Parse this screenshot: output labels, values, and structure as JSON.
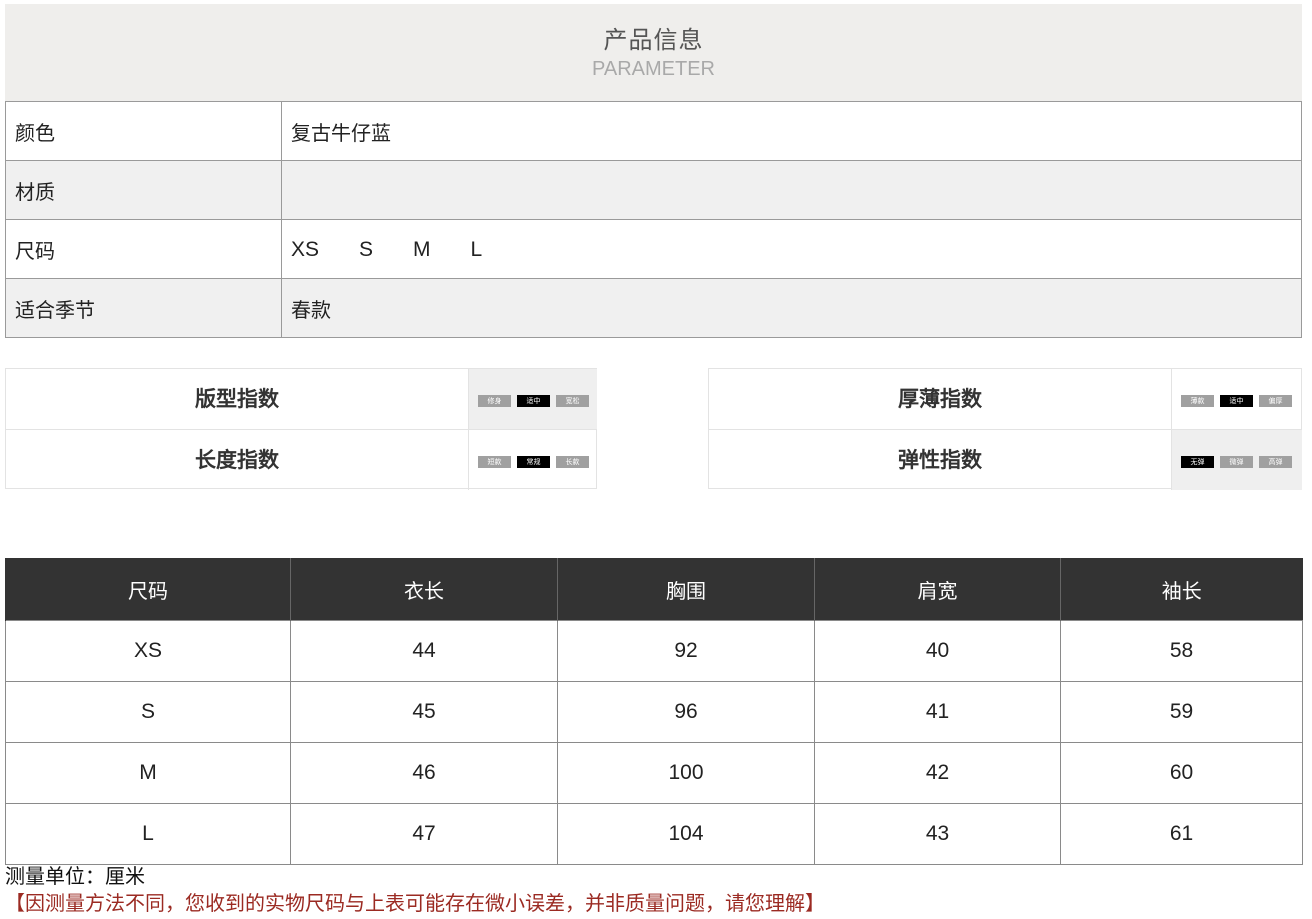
{
  "header": {
    "title_cn": "产品信息",
    "title_en": "PARAMETER"
  },
  "info": {
    "rows": [
      {
        "label": "颜色",
        "value": "复古牛仔蓝"
      },
      {
        "label": "材质",
        "value": ""
      },
      {
        "label": "尺码",
        "sizes": [
          "XS",
          "S",
          "M",
          "L"
        ]
      },
      {
        "label": "适合季节",
        "value": "春款"
      }
    ]
  },
  "indices": {
    "fit": {
      "label": "版型指数",
      "options": [
        "修身",
        "适中",
        "宽松"
      ],
      "selected": "适中"
    },
    "length": {
      "label": "长度指数",
      "options": [
        "短款",
        "常规",
        "长款"
      ],
      "selected": "常规"
    },
    "thickness": {
      "label": "厚薄指数",
      "options": [
        "薄款",
        "适中",
        "偏厚"
      ],
      "selected": "适中"
    },
    "elasticity": {
      "label": "弹性指数",
      "options": [
        "无弹",
        "微弹",
        "高弹"
      ],
      "selected": "无弹"
    }
  },
  "size_table": {
    "headers": [
      "尺码",
      "衣长",
      "胸围",
      "肩宽",
      "袖长"
    ],
    "rows": [
      [
        "XS",
        "44",
        "92",
        "40",
        "58"
      ],
      [
        "S",
        "45",
        "96",
        "41",
        "59"
      ],
      [
        "M",
        "46",
        "100",
        "42",
        "60"
      ],
      [
        "L",
        "47",
        "104",
        "43",
        "61"
      ]
    ]
  },
  "footer": {
    "unit": "测量单位：厘米",
    "note": "【因测量方法不同，您收到的实物尺码与上表可能存在微小误差，并非质量问题，请您理解】"
  },
  "colors": {
    "header_bg": "#efeeec",
    "table_head_bg": "#333333",
    "note_red": "#9b2a22",
    "chip_selected": "#000000",
    "chip_default": "#a0a0a0"
  }
}
